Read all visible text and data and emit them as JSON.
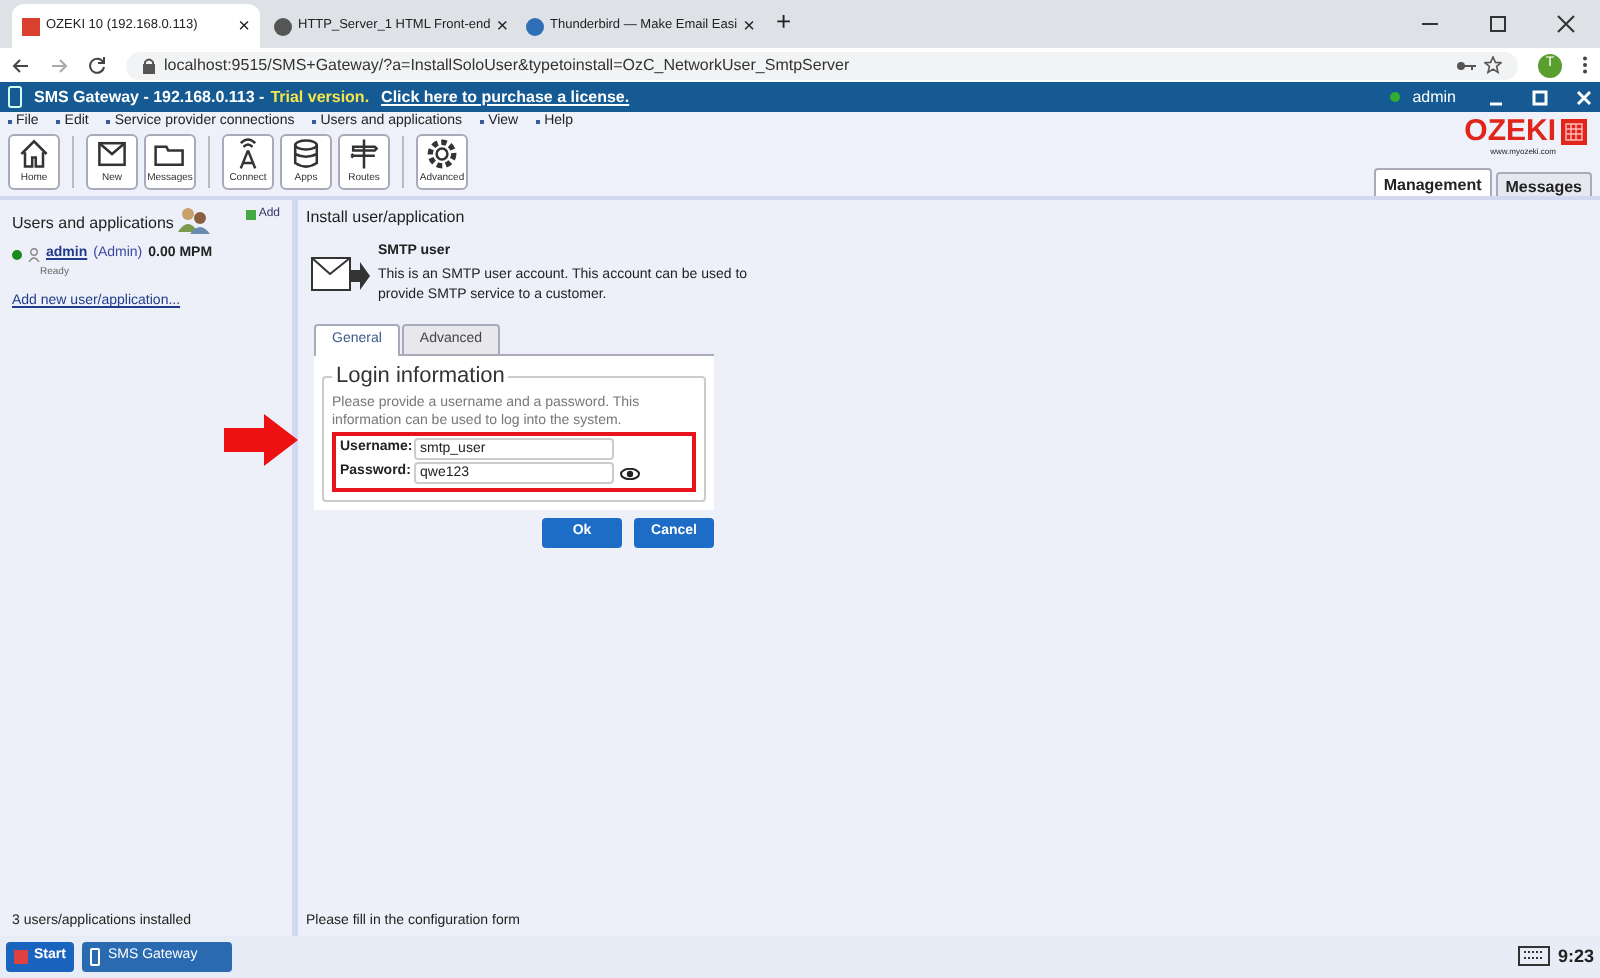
{
  "browser": {
    "tabs": [
      {
        "title": "OZEKI 10 (192.168.0.113)",
        "selected": true,
        "close": "×"
      },
      {
        "title": "HTTP_Server_1 HTML Front-end",
        "selected": false,
        "close": "×"
      },
      {
        "title": "Thunderbird — Make Email Easi",
        "selected": false,
        "close": "×"
      }
    ],
    "new_tab": "+",
    "url": "localhost:9515/SMS+Gateway/?a=InstallSoloUser&typetoinstall=OzC_NetworkUser_SmtpServer",
    "profile": "T"
  },
  "app": {
    "title": "SMS Gateway - 192.168.0.113 -",
    "trial": "Trial version.",
    "purchase_link": "Click here to purchase a license.",
    "user": "admin",
    "menu": [
      "File",
      "Edit",
      "Service provider connections",
      "Users and applications",
      "View",
      "Help"
    ],
    "toolbar": [
      {
        "kind": "home",
        "label": "Home"
      },
      {
        "kind": "new",
        "label": "New"
      },
      {
        "kind": "messages",
        "label": "Messages"
      },
      {
        "kind": "connect",
        "label": "Connect"
      },
      {
        "kind": "apps",
        "label": "Apps"
      },
      {
        "kind": "routes",
        "label": "Routes"
      },
      {
        "kind": "advanced",
        "label": "Advanced"
      }
    ],
    "logo": "OZEKI",
    "logo_url": "www.myozeki.com",
    "view_tabs": [
      {
        "label": "Management",
        "selected": true
      },
      {
        "label": "Messages",
        "selected": false
      }
    ]
  },
  "left_panel": {
    "title": "Users and applications",
    "add": "Add",
    "users": [
      {
        "name": "admin",
        "role": "(Admin)",
        "rate": "0.00 MPM",
        "status": "Ready",
        "online": true
      }
    ],
    "add_link": "Add new user/application...",
    "status": "3 users/applications installed"
  },
  "main_panel": {
    "title": "Install user/application",
    "item_title": "SMTP user",
    "item_desc": "This is an SMTP user account. This account can be used to provide SMTP service to a customer.",
    "tabs": [
      {
        "label": "General",
        "selected": true
      },
      {
        "label": "Advanced",
        "selected": false
      }
    ],
    "legend": "Login information",
    "hint": "Please provide a username and a password. This information can be used to log into the system.",
    "fields": [
      {
        "label": "Username:",
        "value": "smtp_user",
        "kind": "text"
      },
      {
        "label": "Password:",
        "value": "qwe123",
        "kind": "password"
      }
    ],
    "buttons": [
      "Ok",
      "Cancel"
    ],
    "status": "Please fill in the configuration form"
  },
  "taskbar": {
    "start": "Start",
    "app": "SMS Gateway",
    "clock": "9:23"
  }
}
